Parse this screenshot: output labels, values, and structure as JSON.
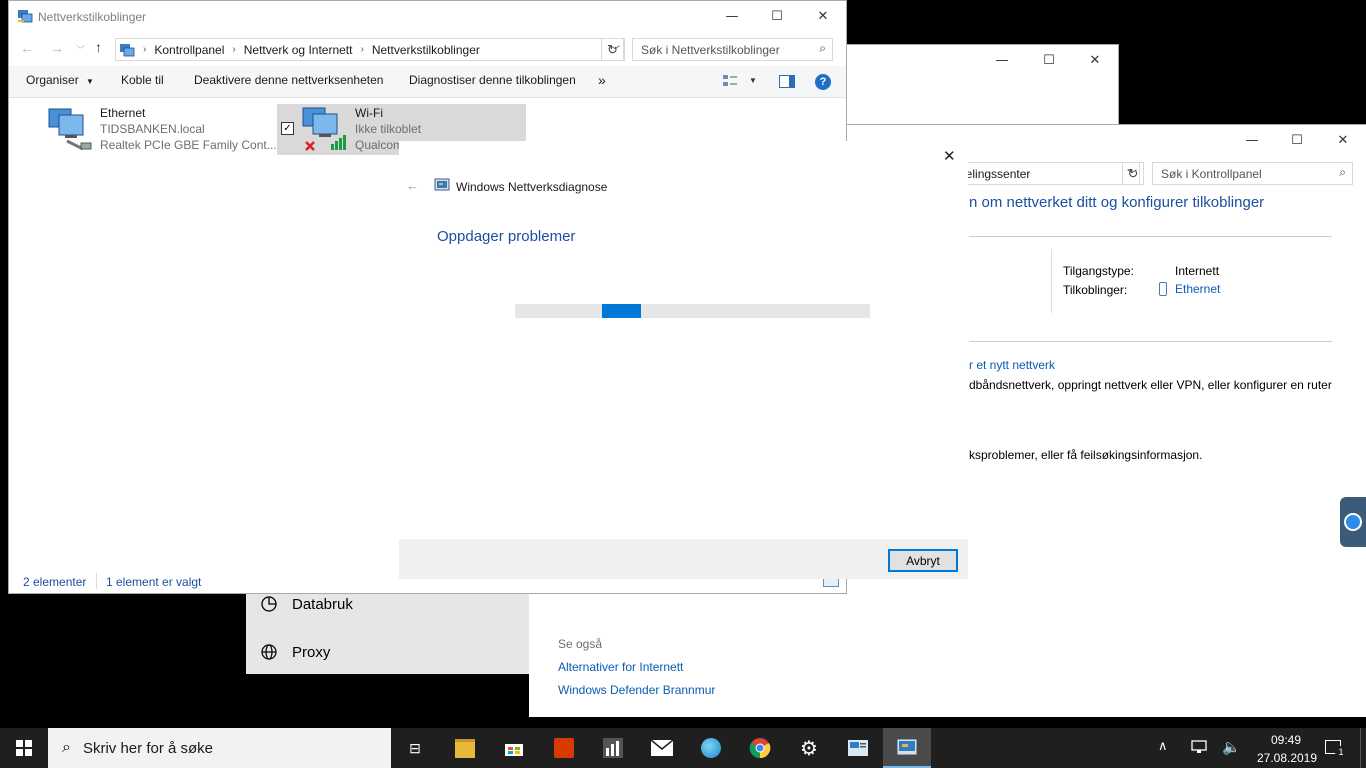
{
  "explorer": {
    "title": "Nettverkstilkoblinger",
    "breadcrumb": [
      "Kontrollpanel",
      "Nettverk og Internett",
      "Nettverkstilkoblinger"
    ],
    "search_placeholder": "Søk i Nettverkstilkoblinger",
    "toolbar": {
      "organize": "Organiser",
      "connect": "Koble til",
      "disable": "Deaktivere denne nettverksenheten",
      "diagnose": "Diagnostiser denne tilkoblingen",
      "more": "»"
    },
    "items": [
      {
        "name": "Ethernet",
        "line1": "TIDSBANKEN.local",
        "line2": "Realtek PCIe GBE Family Cont..."
      },
      {
        "name": "Wi-Fi",
        "line1": "Ikke tilkoblet",
        "line2": "Qualcom"
      }
    ],
    "status": {
      "count": "2 elementer",
      "selected": "1 element er valgt"
    }
  },
  "network_center": {
    "breadcrumb_tail": "g delingssenter",
    "search_placeholder": "Søk i Kontrollpanel",
    "heading": "n om nettverket ditt og konfigurer tilkoblinger",
    "access_type_label": "Tilgangstype:",
    "access_type_value": "Internett",
    "connections_label": "Tilkoblinger:",
    "connections_value": "Ethernet",
    "new_network_link": "r et nytt nettverk",
    "new_network_desc": "dbåndsnettverk, oppringt nettverk eller VPN, eller konfigurer en ruter",
    "troubleshoot_desc": "ksproblemer, eller få feilsøkingsinformasjon.",
    "see_also": "Se også",
    "links": [
      "Alternativer for Internett",
      "Windows Defender Brannmur"
    ]
  },
  "settings_panel": {
    "items": [
      "Databruk",
      "Proxy"
    ]
  },
  "diagnostics": {
    "title": "Windows Nettverksdiagnose",
    "heading": "Oppdager problemer",
    "cancel": "Avbryt"
  },
  "taskbar": {
    "search_placeholder": "Skriv her for å søke",
    "time": "09:49",
    "date": "27.08.2019",
    "notification_count": "1"
  },
  "colors": {
    "accent": "#0078d7",
    "link": "#0a5bb5",
    "taskbar": "#1f1f1f"
  }
}
